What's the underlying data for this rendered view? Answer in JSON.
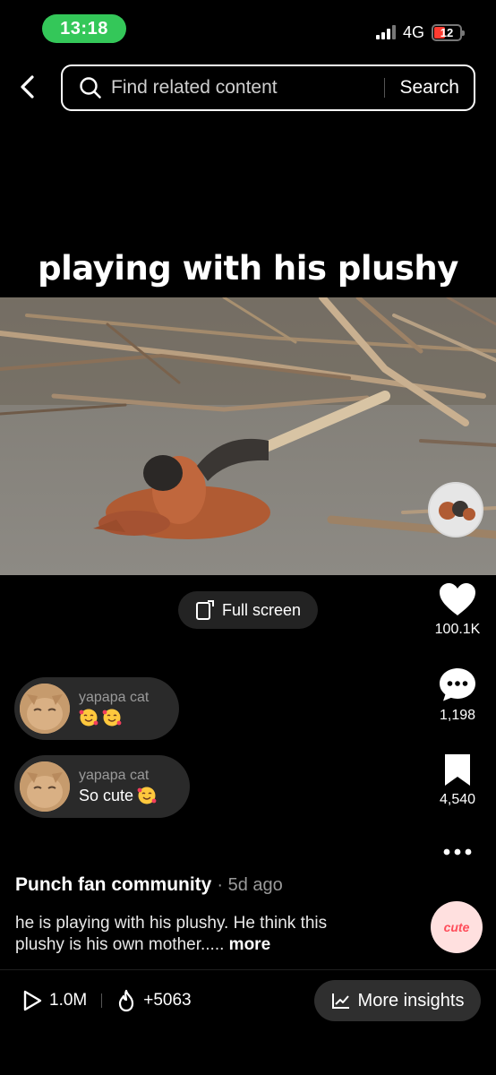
{
  "status_bar": {
    "time": "13:18",
    "network": "4G",
    "battery": "12",
    "battery_color": "#ff3b30",
    "time_pill_color": "#34c759"
  },
  "header": {
    "back_icon": "chevron-left-icon",
    "search_placeholder": "Find related content",
    "search_label": "Search"
  },
  "video": {
    "title": "playing with his plushy",
    "fullscreen_label": "Full screen"
  },
  "actions": {
    "likes": "100.1K",
    "comments": "1,198",
    "saves": "4,540"
  },
  "comments": [
    {
      "user": "yapapa cat",
      "text": "",
      "emojis": 2
    },
    {
      "user": "yapapa cat",
      "text": "So cute",
      "emojis": 1
    }
  ],
  "post": {
    "author": "Punch fan community",
    "posted": "· 5d ago",
    "caption": "he is playing with his plushy. He think this plushy is his own mother.....",
    "more_label": "more",
    "badge": "cute"
  },
  "stats": {
    "views": "1.0M",
    "heat": "+5063",
    "insights_label": "More insights"
  }
}
